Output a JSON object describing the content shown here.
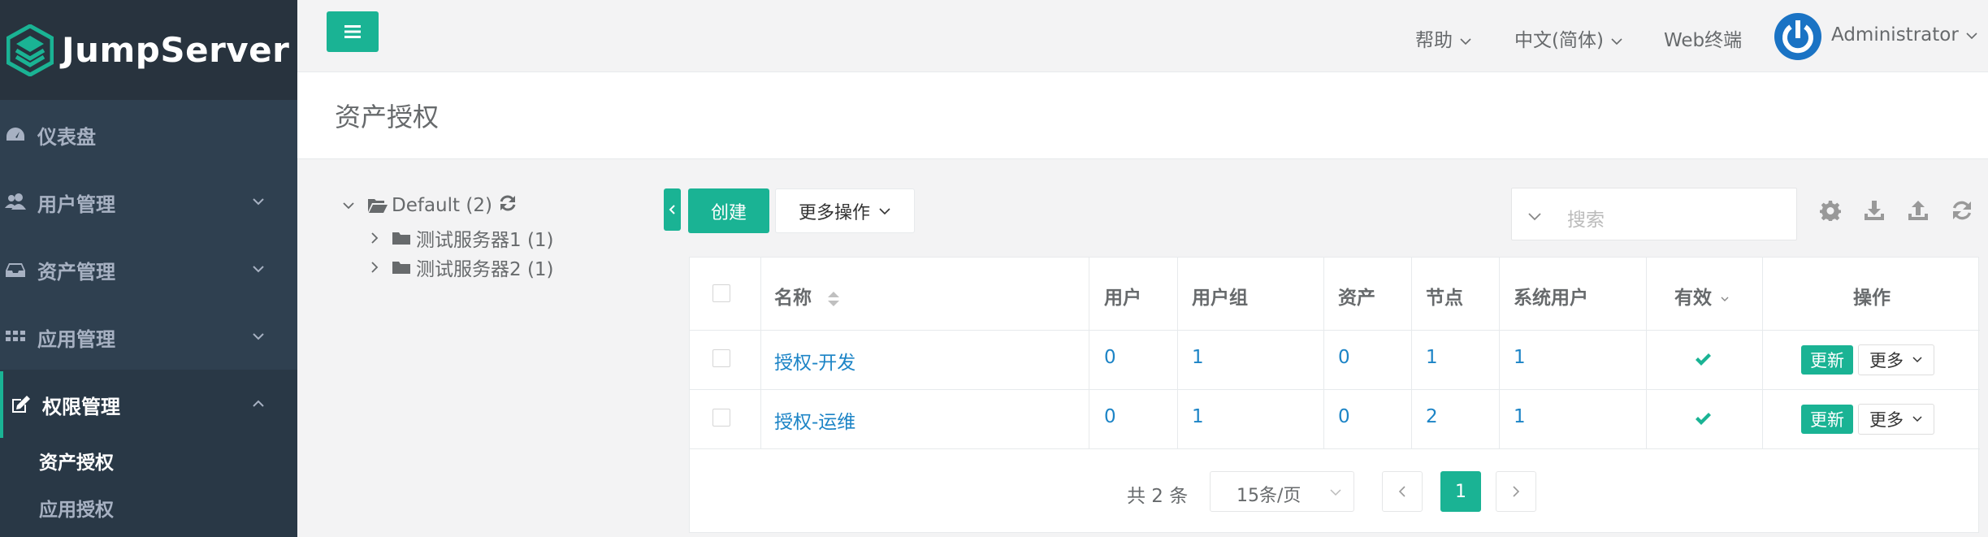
{
  "brand": {
    "name": "JumpServer"
  },
  "sidebar": {
    "items": [
      {
        "label": "仪表盘",
        "icon": "dashboard-icon"
      },
      {
        "label": "用户管理",
        "icon": "users-icon"
      },
      {
        "label": "资产管理",
        "icon": "inbox-icon"
      },
      {
        "label": "应用管理",
        "icon": "grid-icon"
      },
      {
        "label": "权限管理",
        "icon": "edit-icon"
      }
    ],
    "sub_items": [
      {
        "label": "资产授权"
      },
      {
        "label": "应用授权"
      }
    ]
  },
  "topbar": {
    "help": "帮助",
    "language": "中文(简体)",
    "web_terminal": "Web终端",
    "user": "Administrator"
  },
  "page": {
    "title": "资产授权"
  },
  "tree": {
    "root": "Default (2)",
    "children": [
      {
        "label": "测试服务器1 (1)"
      },
      {
        "label": "测试服务器2 (1)"
      }
    ]
  },
  "toolbar": {
    "create": "创建",
    "more_actions": "更多操作",
    "search_placeholder": "搜索"
  },
  "table": {
    "headers": {
      "name": "名称",
      "user": "用户",
      "user_group": "用户组",
      "asset": "资产",
      "node": "节点",
      "system_user": "系统用户",
      "active": "有效",
      "actions": "操作"
    },
    "rows": [
      {
        "name": "授权-开发",
        "user": "0",
        "user_group": "1",
        "asset": "0",
        "node": "1",
        "system_user": "1",
        "update": "更新",
        "more": "更多"
      },
      {
        "name": "授权-运维",
        "user": "0",
        "user_group": "1",
        "asset": "0",
        "node": "2",
        "system_user": "1",
        "update": "更新",
        "more": "更多"
      }
    ]
  },
  "pagination": {
    "total": "共 2 条",
    "page_size": "15条/页",
    "current_page": "1"
  },
  "colors": {
    "accent": "#1ab394",
    "sidebar": "#2f4050",
    "link": "#1c84c6"
  }
}
